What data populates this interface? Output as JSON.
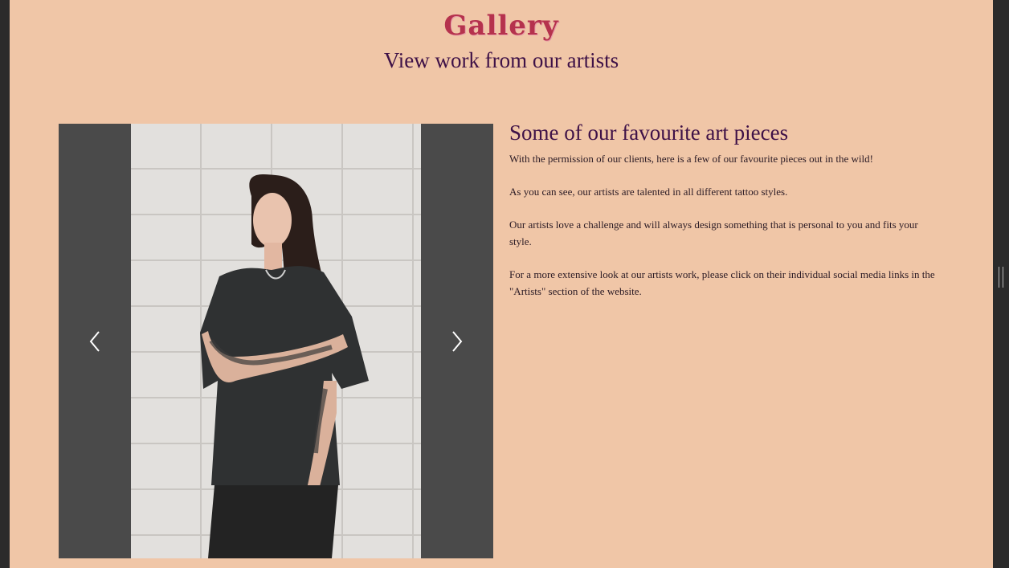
{
  "header": {
    "title": "Gallery",
    "subtitle": "View work from our artists"
  },
  "carousel": {
    "prev_icon": "chevron-left-icon",
    "next_icon": "chevron-right-icon",
    "image": "woman with sleeve tattoos in black t-shirt against white brick wall"
  },
  "content": {
    "heading": "Some of our favourite art pieces",
    "paragraphs": [
      "With the permission of our clients, here is a few of our favourite pieces out in the wild!",
      "As you can see, our artists are talented in all different tattoo styles.",
      "Our artists love a challenge and will always design something that is personal to you and fits your style.",
      "For a more extensive look at our artists work, please click on their individual social media links in the \"Artists\" section of the website."
    ]
  },
  "colors": {
    "page_bg": "#f0c6a7",
    "title": "#b5324d",
    "heading": "#3e1147",
    "carousel_bg": "#4a4a4a"
  }
}
